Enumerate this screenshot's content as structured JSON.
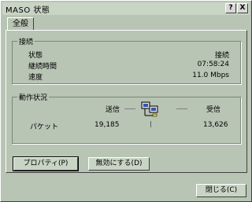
{
  "window": {
    "title": "MASO 状態",
    "help": "?",
    "close": "X"
  },
  "tabs": [
    {
      "label": "全般"
    }
  ],
  "connection": {
    "group_title": "接続",
    "status_label": "状態",
    "status_value": "接続",
    "duration_label": "継続時間",
    "duration_value": "07:58:24",
    "speed_label": "速度",
    "speed_value": "11.0 Mbps"
  },
  "activity": {
    "group_title": "動作状況",
    "sent_label": "送信",
    "received_label": "受信",
    "packets_label": "パケット",
    "packets_sent": "19,185",
    "packets_received": "13,626"
  },
  "buttons": {
    "properties": "プロパティ(P)",
    "disable": "無効にする(D)",
    "close": "閉じる(C)"
  }
}
